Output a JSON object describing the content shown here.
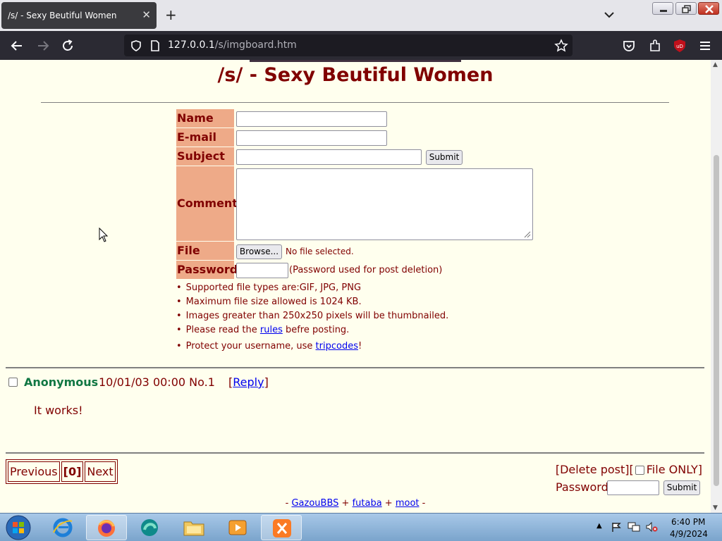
{
  "browser": {
    "tab_title": "/s/ - Sexy Beutiful Women",
    "url_host": "127.0.0.1",
    "url_path": "/s/imgboard.htm"
  },
  "page": {
    "board_title": "/s/ - Sexy Beutiful Women",
    "form": {
      "name_label": "Name",
      "email_label": "E-mail",
      "subject_label": "Subject",
      "comment_label": "Comment",
      "file_label": "File",
      "password_label": "Password",
      "submit_label": "Submit",
      "browse_label": "Browse...",
      "no_file_text": "No file selected.",
      "password_note": "(Password used for post deletion)"
    },
    "rules": {
      "file_types": "Supported file types are:GIF, JPG, PNG",
      "max_size": "Maximum file size allowed is 1024 KB.",
      "thumbnails": "Images greater than 250x250 pixels will be thumbnailed.",
      "read_prefix": "Please read the",
      "read_link": "rules",
      "read_suffix": "befre posting.",
      "protect_prefix": "Protect your username, use",
      "protect_link": "tripcodes",
      "protect_suffix": "!"
    },
    "post": {
      "name": "Anonymous",
      "date": "10/01/03 00:00 No.1",
      "reply_open": "[",
      "reply_link": "Reply",
      "reply_close": "]",
      "body": "It works!"
    },
    "pager": {
      "previous": "Previous",
      "current": "[0]",
      "next": "Next"
    },
    "delete": {
      "prefix": "[Delete post][",
      "file_only": "File ONLY]",
      "password_label": "Password",
      "submit_label": "Submit"
    },
    "footer": {
      "lead": "- ",
      "link1": "GazouBBS",
      "sep1": " + ",
      "link2": "futaba",
      "sep2": " + ",
      "link3": "moot",
      "tail": " -"
    }
  },
  "taskbar": {
    "time": "6:40 PM",
    "date": "4/9/2024"
  }
}
